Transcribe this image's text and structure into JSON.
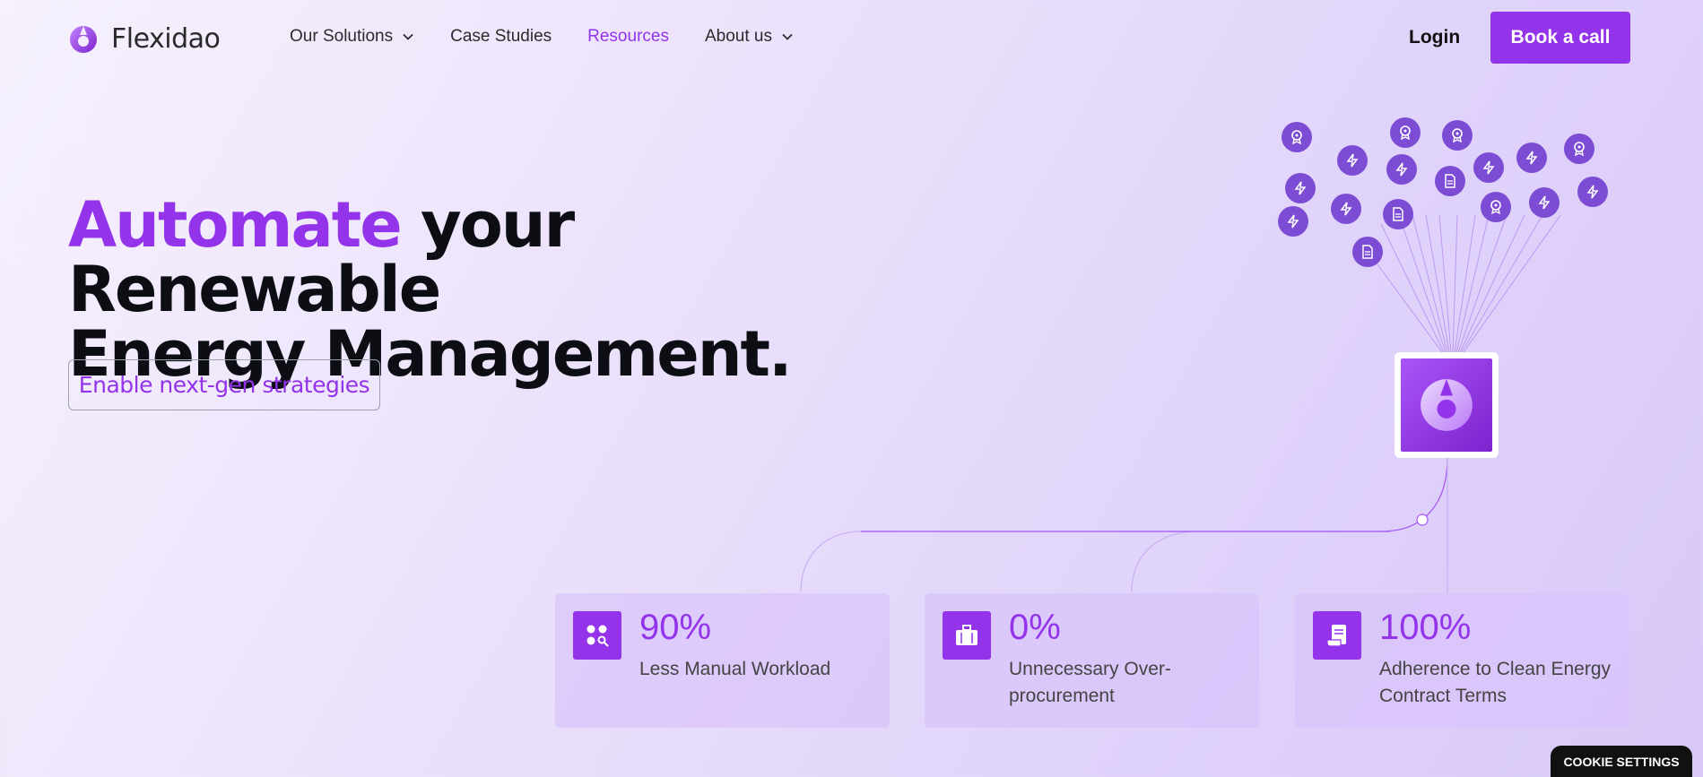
{
  "brand": {
    "name": "Flexidao",
    "accent": "#9333ea"
  },
  "nav": {
    "items": [
      {
        "label": "Our Solutions",
        "has_dropdown": true,
        "active": false
      },
      {
        "label": "Case Studies",
        "has_dropdown": false,
        "active": false
      },
      {
        "label": "Resources",
        "has_dropdown": false,
        "active": true
      },
      {
        "label": "About us",
        "has_dropdown": true,
        "active": false
      }
    ],
    "login_label": "Login",
    "book_label": "Book a call"
  },
  "hero": {
    "accent_word": "Automate",
    "line1_rest": " your Renewable",
    "line2": "Energy Management.",
    "cta_label": "Enable next-gen strategies"
  },
  "stats": [
    {
      "value": "90%",
      "label": "Less Manual Workload",
      "icon": "search-grid-icon"
    },
    {
      "value": "0%",
      "label": "Unnecessary Over-procurement",
      "icon": "briefcase-icon"
    },
    {
      "value": "100%",
      "label": "Adherence to Clean Energy Contract Terms",
      "icon": "contract-icon"
    }
  ],
  "cookie_label": "COOKIE SETTINGS"
}
